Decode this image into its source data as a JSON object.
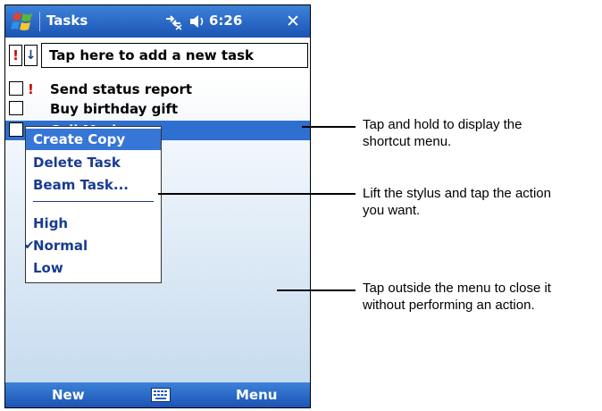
{
  "title_bar": {
    "app_title": "Tasks",
    "time": "6:26",
    "close": "✕"
  },
  "new_task": {
    "priority_label": "!",
    "sort_label": "↓",
    "placeholder": "Tap here to add a new task"
  },
  "tasks": [
    {
      "priority": "!",
      "label": "Send status report"
    },
    {
      "priority": "",
      "label": "Buy birthday gift"
    },
    {
      "priority": "",
      "label": "Call Maria"
    }
  ],
  "context_menu": {
    "items": [
      "Create Copy",
      "Delete Task",
      "Beam Task..."
    ],
    "priority_items": [
      "High",
      "Normal",
      "Low"
    ],
    "checked_item": "Normal",
    "check_mark": "✔"
  },
  "bottom_bar": {
    "left_label": "New",
    "right_label": "Menu",
    "center_icon": "keyboard-icon"
  },
  "callouts": [
    {
      "lines": [
        "Tap and hold to display the",
        "shortcut menu."
      ]
    },
    {
      "lines": [
        "Lift the stylus and tap the action",
        "you want."
      ]
    },
    {
      "lines": [
        "Tap outside the menu to close it",
        "without performing an action."
      ]
    }
  ],
  "colors": {
    "bar_blue": "#1b54b5",
    "selection_blue": "#2e6fcf",
    "menu_text": "#1a3c8f",
    "priority_red": "#cc0000"
  }
}
